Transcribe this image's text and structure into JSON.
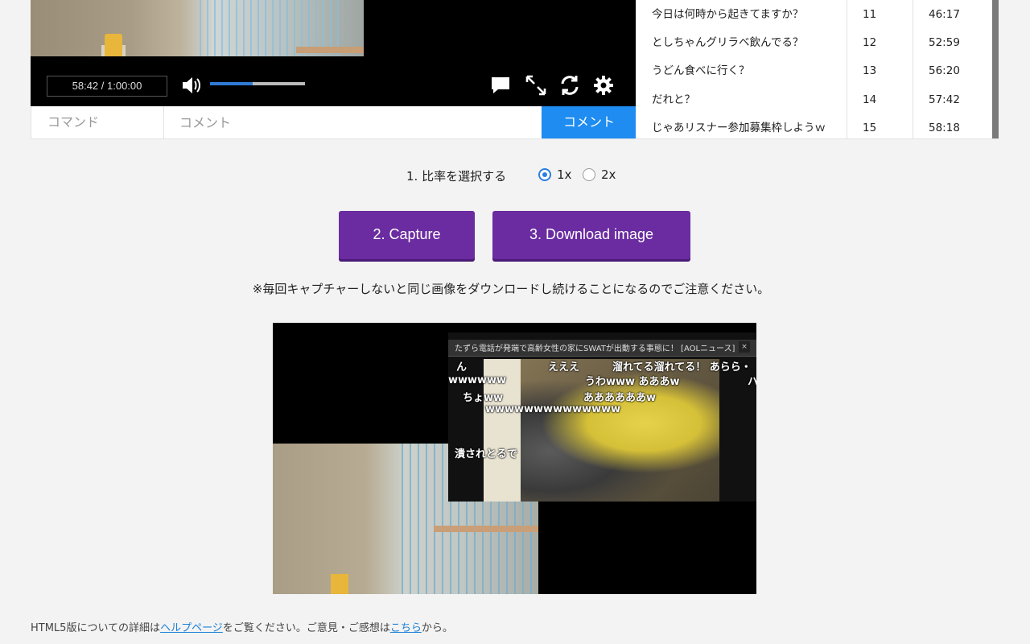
{
  "player": {
    "time_display": "58:42 / 1:00:00",
    "volume_fraction": 0.45
  },
  "comment_bar": {
    "command_placeholder": "コマンド",
    "comment_placeholder": "コメント",
    "submit_label": "コメント"
  },
  "comment_list": [
    {
      "text": "今日は何時から起きてますか？",
      "no": "11",
      "time": "46:17"
    },
    {
      "text": "としちゃんグリラベ飲んでる？",
      "no": "12",
      "time": "52:59"
    },
    {
      "text": "うどん食べに行く？",
      "no": "13",
      "time": "56:20"
    },
    {
      "text": "だれと？",
      "no": "14",
      "time": "57:42"
    },
    {
      "text": "じゃあリスナー参加募集枠しようｗ",
      "no": "15",
      "time": "58:18"
    }
  ],
  "capture_tool": {
    "ratio_label": "1. 比率を選択する",
    "ratio_options": [
      "1x",
      "2x"
    ],
    "ratio_selected": "1x",
    "capture_button": "2. Capture",
    "download_button": "3. Download image",
    "notice": "※毎回キャプチャーしないと同じ画像をダウンロードし続けることになるのでご注意ください。"
  },
  "captured_image": {
    "stream_title": "たずら電話が発端で高齢女性の家にSWATが出動する事態に！ [AOLニュース]",
    "close_glyph": "×",
    "danmaku": [
      "ん",
      "えええ",
      "溜れてる溜れてる！ あらら・",
      "wwwwww",
      "うわwww あああw",
      "ちょww",
      "ああああああw",
      "wwwwwwwwwwwwww",
      "潰されとるで",
      "ハ"
    ]
  },
  "footer": {
    "text1": "HTML5版についての詳細は",
    "link1": "ヘルプページ",
    "text2": "をご覧ください。ご意見・ご感想は",
    "link2": "こちら",
    "text3": "から。"
  }
}
